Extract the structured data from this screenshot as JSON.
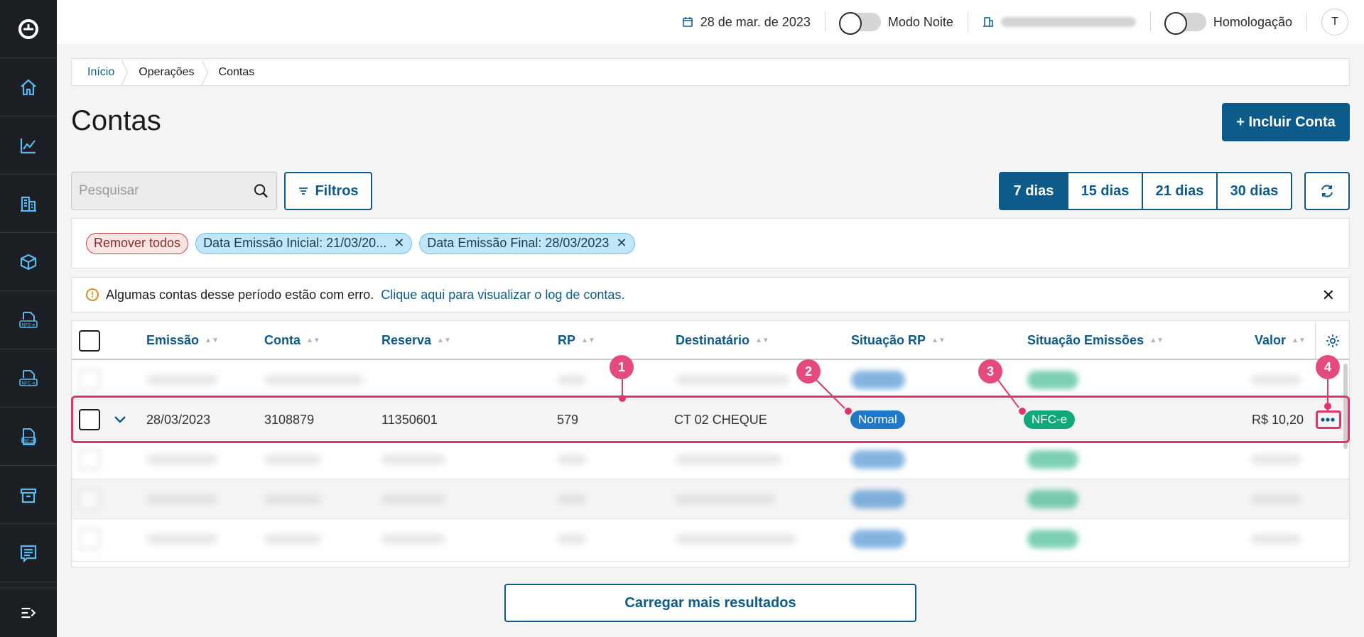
{
  "topbar": {
    "date": "28 de mar. de 2023",
    "night_mode_label": "Modo Noite",
    "homologation_label": "Homologação",
    "avatar_initial": "T"
  },
  "breadcrumb": [
    "Início",
    "Operações",
    "Contas"
  ],
  "page": {
    "title": "Contas",
    "add_button": "+ Incluir Conta"
  },
  "search": {
    "placeholder": "Pesquisar"
  },
  "filters_button": "Filtros",
  "ranges": [
    "7 dias",
    "15 dias",
    "21 dias",
    "30 dias"
  ],
  "active_range": "7 dias",
  "chips": {
    "remove_all": "Remover todos",
    "filters": [
      "Data Emissão Inicial: 21/03/20...",
      "Data Emissão Final: 28/03/2023"
    ]
  },
  "alert": {
    "message": "Algumas contas desse período estão com erro.",
    "link": "Clique aqui para visualizar o log de contas."
  },
  "table": {
    "columns": [
      "Emissão",
      "Conta",
      "Reserva",
      "RP",
      "Destinatário",
      "Situação RP",
      "Situação Emissões",
      "Valor"
    ],
    "highlighted_row": {
      "emissao": "28/03/2023",
      "conta": "3108879",
      "reserva": "11350601",
      "rp": "579",
      "destinatario": "CT 02 CHEQUE",
      "situacao_rp": "Normal",
      "situacao_emissoes": "NFC-e",
      "valor": "R$ 10,20"
    }
  },
  "annotations": [
    "1",
    "2",
    "3",
    "4"
  ],
  "load_more": "Carregar mais resultados",
  "colors": {
    "primary": "#0c5b8a",
    "sidebar": "#1b1f24",
    "highlight": "#e0356a",
    "badge_blue": "#1f78c8",
    "badge_green": "#11a87a"
  }
}
